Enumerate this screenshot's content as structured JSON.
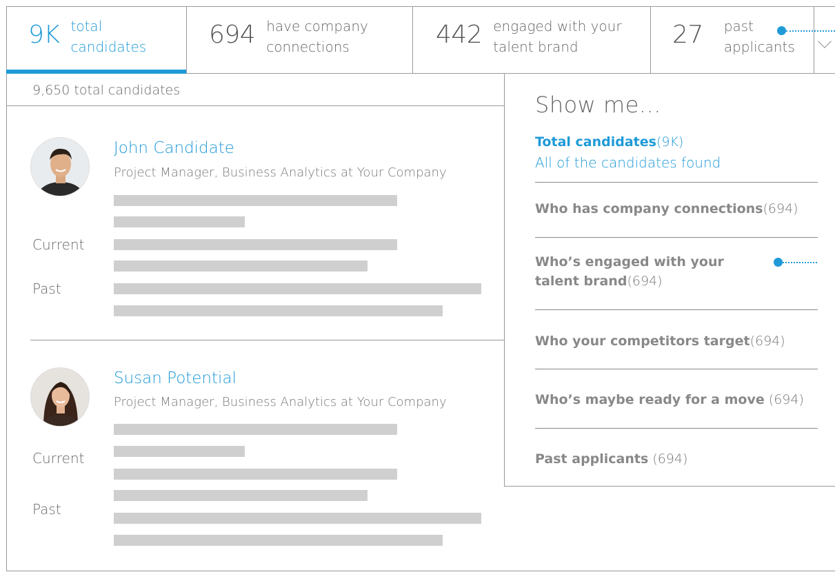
{
  "tabs": [
    {
      "num": "9K",
      "label": "total candidates"
    },
    {
      "num": "694",
      "label": "have company connections"
    },
    {
      "num": "442",
      "label": "engaged with your talent brand"
    },
    {
      "num": "27",
      "label": "past applicants"
    }
  ],
  "results": {
    "count_text": "9,650 total candidates"
  },
  "candidates": [
    {
      "name": "John Candidate",
      "title": "Project Manager, Business Analytics at Your Company",
      "current_label": "Current",
      "past_label": "Past"
    },
    {
      "name": "Susan Potential",
      "title": "Project Manager, Business Analytics at Your Company",
      "current_label": "Current",
      "past_label": "Past"
    }
  ],
  "filter_panel": {
    "title": "Show me...",
    "options": [
      {
        "label": "Total candidates",
        "count": "(9K)",
        "description": "All of the candidates found",
        "selected": true
      },
      {
        "label": "Who has company connections",
        "count": "(694)"
      },
      {
        "label": "Who’s engaged with your talent brand",
        "count": "(694)"
      },
      {
        "label": "Who your competitors target",
        "count": "(694)"
      },
      {
        "label": "Who’s maybe ready for a move",
        "count": "(694)"
      },
      {
        "label": "Past applicants",
        "count": "(694)"
      }
    ]
  },
  "colors": {
    "accent": "#1f9ad7",
    "placeholder_bar": "#cfcfcf",
    "divider": "#999999"
  }
}
